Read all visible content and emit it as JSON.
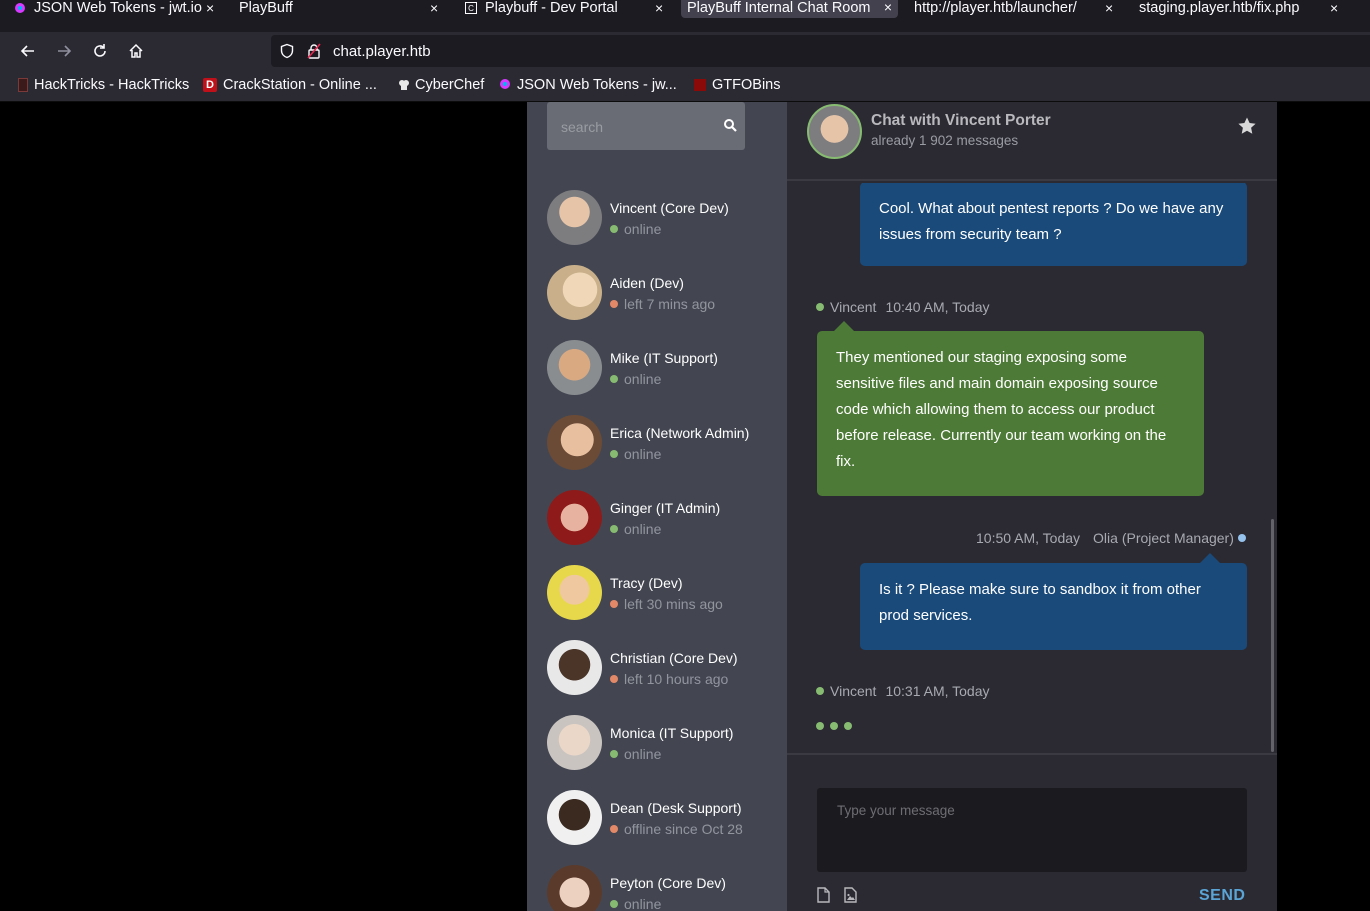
{
  "browser": {
    "tabs": [
      {
        "title": "JSON Web Tokens - jwt.io",
        "active": false
      },
      {
        "title": "PlayBuff",
        "active": false
      },
      {
        "title": "Playbuff - Dev Portal",
        "active": false
      },
      {
        "title": "PlayBuff Internal Chat Room",
        "active": true
      },
      {
        "title": "http://player.htb/launcher/",
        "active": false
      },
      {
        "title": "staging.player.htb/fix.php",
        "active": false
      }
    ],
    "url": "chat.player.htb",
    "bookmarks": [
      {
        "label": "HackTricks - HackTricks"
      },
      {
        "label": "CrackStation - Online ..."
      },
      {
        "label": "CyberChef"
      },
      {
        "label": "JSON Web Tokens - jw..."
      },
      {
        "label": "GTFOBins"
      }
    ]
  },
  "people": {
    "search_placeholder": "search",
    "contacts": [
      {
        "name": "Vincent (Core Dev)",
        "status": "online",
        "state": "online"
      },
      {
        "name": "Aiden (Dev)",
        "status": "left 7 mins ago",
        "state": "offline"
      },
      {
        "name": "Mike (IT Support)",
        "status": "online",
        "state": "online"
      },
      {
        "name": "Erica (Network Admin)",
        "status": "online",
        "state": "online"
      },
      {
        "name": "Ginger (IT Admin)",
        "status": "online",
        "state": "online"
      },
      {
        "name": "Tracy (Dev)",
        "status": "left 30 mins ago",
        "state": "offline"
      },
      {
        "name": "Christian (Core Dev)",
        "status": "left 10 hours ago",
        "state": "offline"
      },
      {
        "name": "Monica (IT Support)",
        "status": "online",
        "state": "online"
      },
      {
        "name": "Dean (Desk Support)",
        "status": "offline since Oct 28",
        "state": "offline"
      },
      {
        "name": "Peyton (Core Dev)",
        "status": "online",
        "state": "online"
      }
    ]
  },
  "chat": {
    "title": "Chat with Vincent Porter",
    "subtitle": "already 1 902 messages",
    "messages": [
      {
        "text": "Cool. What about pentest reports ? Do we have any issues from security team ?"
      },
      {
        "sender": "Vincent",
        "time": "10:40 AM, Today",
        "text": "They mentioned our staging exposing some sensitive files and main domain exposing source code which allowing them to access our product before release. Currently our team working on the fix."
      },
      {
        "sender": "Olia (Project Manager)",
        "time": "10:50 AM, Today",
        "text": "Is it ? Please make sure to sandbox it from other prod services."
      },
      {
        "sender": "Vincent",
        "time": "10:31 AM, Today"
      }
    ],
    "compose_placeholder": "Type your message",
    "send_label": "SEND"
  },
  "colors": {
    "online": "#86bb71",
    "offline": "#e38968",
    "me": "#94c2ed",
    "bubble_other": "#1a4a7a",
    "bubble_mine": "#4d7a36"
  }
}
